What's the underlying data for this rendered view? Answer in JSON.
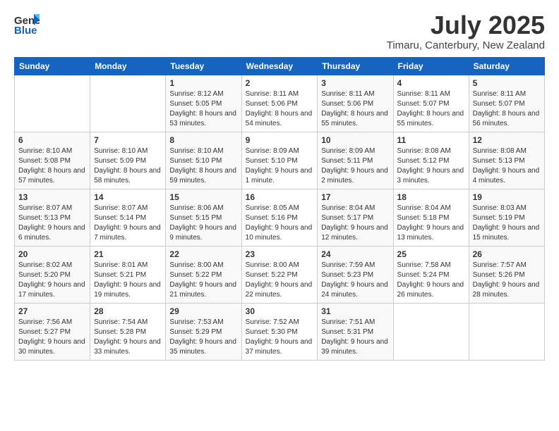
{
  "logo": {
    "general": "General",
    "blue": "Blue"
  },
  "title": "July 2025",
  "location": "Timaru, Canterbury, New Zealand",
  "weekdays": [
    "Sunday",
    "Monday",
    "Tuesday",
    "Wednesday",
    "Thursday",
    "Friday",
    "Saturday"
  ],
  "weeks": [
    [
      {
        "day": "",
        "info": ""
      },
      {
        "day": "",
        "info": ""
      },
      {
        "day": "1",
        "info": "Sunrise: 8:12 AM\nSunset: 5:05 PM\nDaylight: 8 hours and 53 minutes."
      },
      {
        "day": "2",
        "info": "Sunrise: 8:11 AM\nSunset: 5:06 PM\nDaylight: 8 hours and 54 minutes."
      },
      {
        "day": "3",
        "info": "Sunrise: 8:11 AM\nSunset: 5:06 PM\nDaylight: 8 hours and 55 minutes."
      },
      {
        "day": "4",
        "info": "Sunrise: 8:11 AM\nSunset: 5:07 PM\nDaylight: 8 hours and 55 minutes."
      },
      {
        "day": "5",
        "info": "Sunrise: 8:11 AM\nSunset: 5:07 PM\nDaylight: 8 hours and 56 minutes."
      }
    ],
    [
      {
        "day": "6",
        "info": "Sunrise: 8:10 AM\nSunset: 5:08 PM\nDaylight: 8 hours and 57 minutes."
      },
      {
        "day": "7",
        "info": "Sunrise: 8:10 AM\nSunset: 5:09 PM\nDaylight: 8 hours and 58 minutes."
      },
      {
        "day": "8",
        "info": "Sunrise: 8:10 AM\nSunset: 5:10 PM\nDaylight: 8 hours and 59 minutes."
      },
      {
        "day": "9",
        "info": "Sunrise: 8:09 AM\nSunset: 5:10 PM\nDaylight: 9 hours and 1 minute."
      },
      {
        "day": "10",
        "info": "Sunrise: 8:09 AM\nSunset: 5:11 PM\nDaylight: 9 hours and 2 minutes."
      },
      {
        "day": "11",
        "info": "Sunrise: 8:08 AM\nSunset: 5:12 PM\nDaylight: 9 hours and 3 minutes."
      },
      {
        "day": "12",
        "info": "Sunrise: 8:08 AM\nSunset: 5:13 PM\nDaylight: 9 hours and 4 minutes."
      }
    ],
    [
      {
        "day": "13",
        "info": "Sunrise: 8:07 AM\nSunset: 5:13 PM\nDaylight: 9 hours and 6 minutes."
      },
      {
        "day": "14",
        "info": "Sunrise: 8:07 AM\nSunset: 5:14 PM\nDaylight: 9 hours and 7 minutes."
      },
      {
        "day": "15",
        "info": "Sunrise: 8:06 AM\nSunset: 5:15 PM\nDaylight: 9 hours and 9 minutes."
      },
      {
        "day": "16",
        "info": "Sunrise: 8:05 AM\nSunset: 5:16 PM\nDaylight: 9 hours and 10 minutes."
      },
      {
        "day": "17",
        "info": "Sunrise: 8:04 AM\nSunset: 5:17 PM\nDaylight: 9 hours and 12 minutes."
      },
      {
        "day": "18",
        "info": "Sunrise: 8:04 AM\nSunset: 5:18 PM\nDaylight: 9 hours and 13 minutes."
      },
      {
        "day": "19",
        "info": "Sunrise: 8:03 AM\nSunset: 5:19 PM\nDaylight: 9 hours and 15 minutes."
      }
    ],
    [
      {
        "day": "20",
        "info": "Sunrise: 8:02 AM\nSunset: 5:20 PM\nDaylight: 9 hours and 17 minutes."
      },
      {
        "day": "21",
        "info": "Sunrise: 8:01 AM\nSunset: 5:21 PM\nDaylight: 9 hours and 19 minutes."
      },
      {
        "day": "22",
        "info": "Sunrise: 8:00 AM\nSunset: 5:22 PM\nDaylight: 9 hours and 21 minutes."
      },
      {
        "day": "23",
        "info": "Sunrise: 8:00 AM\nSunset: 5:22 PM\nDaylight: 9 hours and 22 minutes."
      },
      {
        "day": "24",
        "info": "Sunrise: 7:59 AM\nSunset: 5:23 PM\nDaylight: 9 hours and 24 minutes."
      },
      {
        "day": "25",
        "info": "Sunrise: 7:58 AM\nSunset: 5:24 PM\nDaylight: 9 hours and 26 minutes."
      },
      {
        "day": "26",
        "info": "Sunrise: 7:57 AM\nSunset: 5:26 PM\nDaylight: 9 hours and 28 minutes."
      }
    ],
    [
      {
        "day": "27",
        "info": "Sunrise: 7:56 AM\nSunset: 5:27 PM\nDaylight: 9 hours and 30 minutes."
      },
      {
        "day": "28",
        "info": "Sunrise: 7:54 AM\nSunset: 5:28 PM\nDaylight: 9 hours and 33 minutes."
      },
      {
        "day": "29",
        "info": "Sunrise: 7:53 AM\nSunset: 5:29 PM\nDaylight: 9 hours and 35 minutes."
      },
      {
        "day": "30",
        "info": "Sunrise: 7:52 AM\nSunset: 5:30 PM\nDaylight: 9 hours and 37 minutes."
      },
      {
        "day": "31",
        "info": "Sunrise: 7:51 AM\nSunset: 5:31 PM\nDaylight: 9 hours and 39 minutes."
      },
      {
        "day": "",
        "info": ""
      },
      {
        "day": "",
        "info": ""
      }
    ]
  ]
}
